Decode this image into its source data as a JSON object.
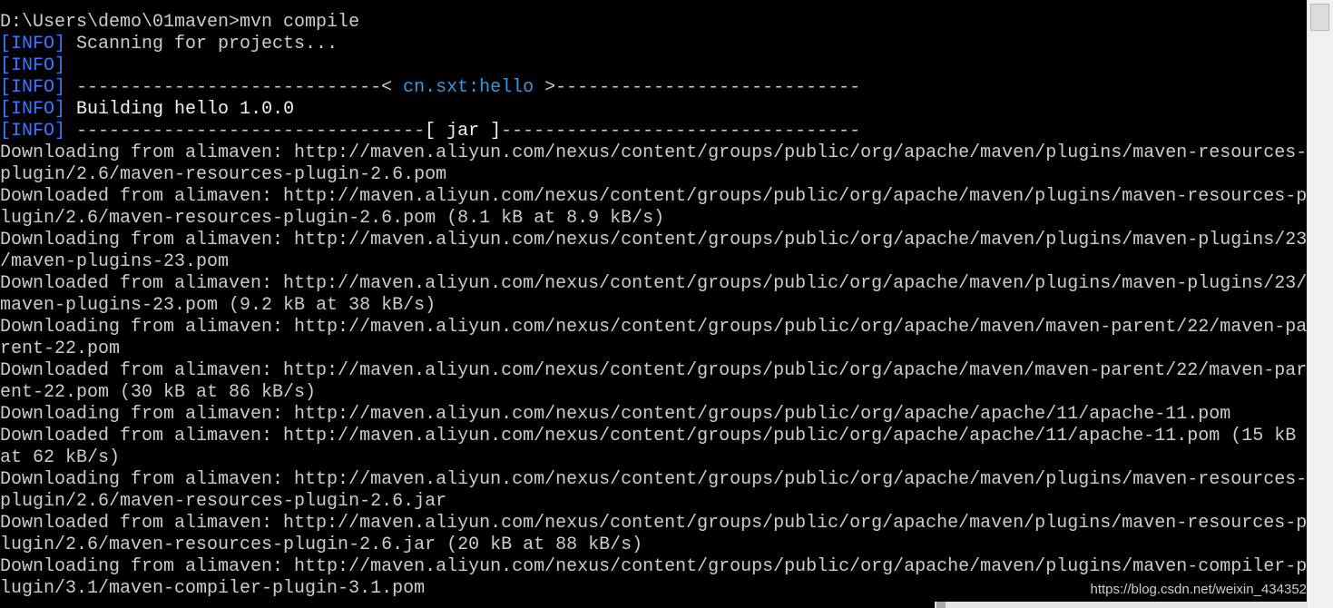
{
  "terminal": {
    "palette": {
      "normal": "#cccccc",
      "info": "#3b78ff",
      "accent": "#3a96dd",
      "bright": "#f2f2f2",
      "background": "#000000"
    },
    "lines": [
      {
        "segments": [
          {
            "text": "D:\\Users\\demo\\01maven>mvn compile",
            "style": "normal"
          }
        ]
      },
      {
        "segments": [
          {
            "text": "[INFO]",
            "style": "info"
          },
          {
            "text": " Scanning for projects...",
            "style": "normal"
          }
        ]
      },
      {
        "segments": [
          {
            "text": "[INFO]",
            "style": "info"
          }
        ]
      },
      {
        "segments": [
          {
            "text": "[INFO]",
            "style": "info"
          },
          {
            "text": " ----------------------------< ",
            "style": "normal"
          },
          {
            "text": "cn.sxt:hello",
            "style": "accent"
          },
          {
            "text": " >----------------------------",
            "style": "normal"
          }
        ]
      },
      {
        "segments": [
          {
            "text": "[INFO]",
            "style": "info"
          },
          {
            "text": " ",
            "style": "normal"
          },
          {
            "text": "Building hello 1.0.0",
            "style": "bright"
          }
        ]
      },
      {
        "segments": [
          {
            "text": "[INFO]",
            "style": "info"
          },
          {
            "text": " --------------------------------",
            "style": "normal"
          },
          {
            "text": "[ jar ]",
            "style": "bright"
          },
          {
            "text": "---------------------------------",
            "style": "normal"
          }
        ]
      },
      {
        "segments": [
          {
            "text": "Downloading from alimaven: http://maven.aliyun.com/nexus/content/groups/public/org/apache/maven/plugins/maven-resources-",
            "style": "normal"
          }
        ]
      },
      {
        "segments": [
          {
            "text": "plugin/2.6/maven-resources-plugin-2.6.pom",
            "style": "normal"
          }
        ]
      },
      {
        "segments": [
          {
            "text": "Downloaded from alimaven: http://maven.aliyun.com/nexus/content/groups/public/org/apache/maven/plugins/maven-resources-p",
            "style": "normal"
          }
        ]
      },
      {
        "segments": [
          {
            "text": "lugin/2.6/maven-resources-plugin-2.6.pom (8.1 kB at 8.9 kB/s)",
            "style": "normal"
          }
        ]
      },
      {
        "segments": [
          {
            "text": "Downloading from alimaven: http://maven.aliyun.com/nexus/content/groups/public/org/apache/maven/plugins/maven-plugins/23",
            "style": "normal"
          }
        ]
      },
      {
        "segments": [
          {
            "text": "/maven-plugins-23.pom",
            "style": "normal"
          }
        ]
      },
      {
        "segments": [
          {
            "text": "Downloaded from alimaven: http://maven.aliyun.com/nexus/content/groups/public/org/apache/maven/plugins/maven-plugins/23/",
            "style": "normal"
          }
        ]
      },
      {
        "segments": [
          {
            "text": "maven-plugins-23.pom (9.2 kB at 38 kB/s)",
            "style": "normal"
          }
        ]
      },
      {
        "segments": [
          {
            "text": "Downloading from alimaven: http://maven.aliyun.com/nexus/content/groups/public/org/apache/maven/maven-parent/22/maven-pa",
            "style": "normal"
          }
        ]
      },
      {
        "segments": [
          {
            "text": "rent-22.pom",
            "style": "normal"
          }
        ]
      },
      {
        "segments": [
          {
            "text": "Downloaded from alimaven: http://maven.aliyun.com/nexus/content/groups/public/org/apache/maven/maven-parent/22/maven-par",
            "style": "normal"
          }
        ]
      },
      {
        "segments": [
          {
            "text": "ent-22.pom (30 kB at 86 kB/s)",
            "style": "normal"
          }
        ]
      },
      {
        "segments": [
          {
            "text": "Downloading from alimaven: http://maven.aliyun.com/nexus/content/groups/public/org/apache/apache/11/apache-11.pom",
            "style": "normal"
          }
        ]
      },
      {
        "segments": [
          {
            "text": "Downloaded from alimaven: http://maven.aliyun.com/nexus/content/groups/public/org/apache/apache/11/apache-11.pom (15 kB",
            "style": "normal"
          }
        ]
      },
      {
        "segments": [
          {
            "text": "at 62 kB/s)",
            "style": "normal"
          }
        ]
      },
      {
        "segments": [
          {
            "text": "Downloading from alimaven: http://maven.aliyun.com/nexus/content/groups/public/org/apache/maven/plugins/maven-resources-",
            "style": "normal"
          }
        ]
      },
      {
        "segments": [
          {
            "text": "plugin/2.6/maven-resources-plugin-2.6.jar",
            "style": "normal"
          }
        ]
      },
      {
        "segments": [
          {
            "text": "Downloaded from alimaven: http://maven.aliyun.com/nexus/content/groups/public/org/apache/maven/plugins/maven-resources-p",
            "style": "normal"
          }
        ]
      },
      {
        "segments": [
          {
            "text": "lugin/2.6/maven-resources-plugin-2.6.jar (20 kB at 88 kB/s)",
            "style": "normal"
          }
        ]
      },
      {
        "segments": [
          {
            "text": "Downloading from alimaven: http://maven.aliyun.com/nexus/content/groups/public/org/apache/maven/plugins/maven-compiler-p",
            "style": "normal"
          }
        ]
      },
      {
        "segments": [
          {
            "text": "lugin/3.1/maven-compiler-plugin-3.1.pom",
            "style": "normal"
          }
        ]
      }
    ]
  },
  "scrollbar": {
    "vertical_position": 0
  },
  "watermark": {
    "text": "https://blog.csdn.net/weixin_434352"
  }
}
